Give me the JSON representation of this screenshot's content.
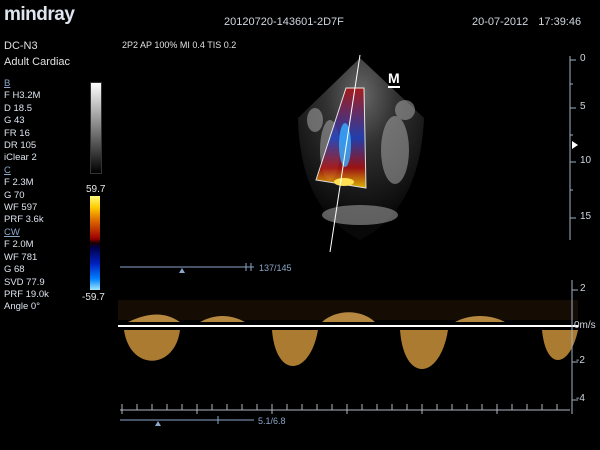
{
  "header": {
    "brand": "mindray",
    "file_id": "20120720-143601-2D7F",
    "date": "20-07-2012",
    "time": "17:39:46"
  },
  "left": {
    "probe": "DC-N3",
    "preset": "Adult Cardiac"
  },
  "acquisition": "2P2  AP 100%  MI 0.4  TIS 0.2",
  "params": {
    "b": {
      "header": "B",
      "lines": [
        "F H3.2M",
        "D 18.5",
        "G 43",
        "FR 16",
        "DR 105",
        "iClear 2"
      ]
    },
    "c": {
      "header": "C",
      "lines": [
        "F 2.3M",
        "G 70",
        "WF 597",
        "PRF 3.6k"
      ]
    },
    "cw": {
      "header": "CW",
      "lines": [
        "F 2.0M",
        "WF 781",
        "G 68",
        "SVD 77.9",
        "PRF 19.0k",
        "Angle 0°"
      ]
    }
  },
  "color_scale": {
    "max": "59.7",
    "min": "-59.7"
  },
  "depth_scale": [
    "0",
    "5",
    "10",
    "15"
  ],
  "m_marker": "M",
  "gate_readout": "137/145",
  "velocity_scale": [
    "2",
    "0m/s",
    "-2",
    "-4"
  ],
  "sweep_readout": "5.1/6.8",
  "colors": {
    "text": "#e6e6e6",
    "accent_blue": "#8ba6c8",
    "doppler": "#c8903a",
    "background": "#000000"
  }
}
